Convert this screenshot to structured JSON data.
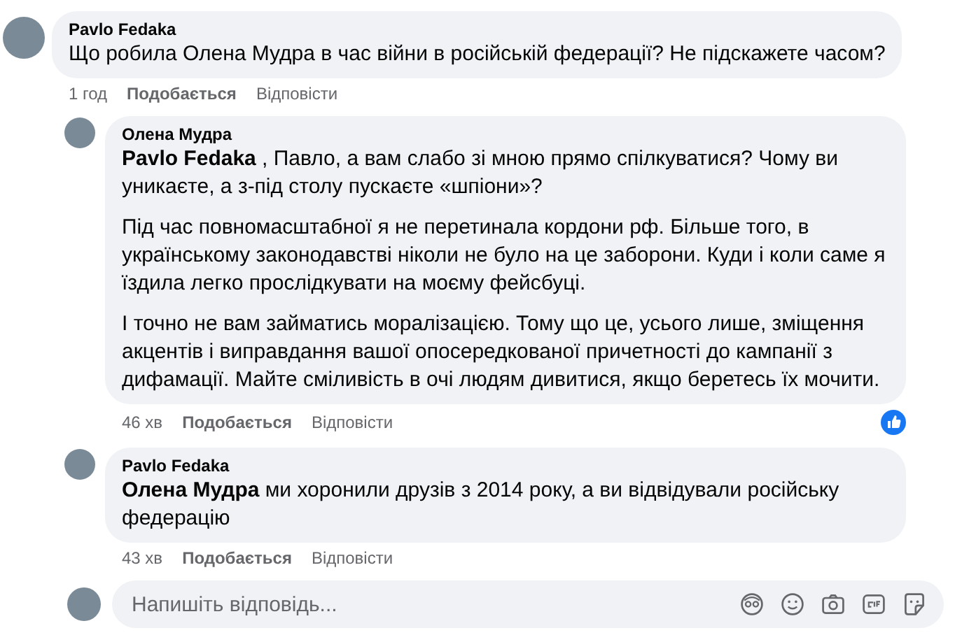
{
  "comments": [
    {
      "author": "Pavlo Fedaka",
      "paragraphs": [
        "Що робила Олена Мудра в час війни в російській федерації? Не підскажете часом?"
      ],
      "time": "1 год",
      "like_label": "Подобається",
      "reply_label": "Відповісти",
      "reply": false,
      "liked_reaction": false
    },
    {
      "author": "Олена Мудра",
      "paragraphs": [
        "**Pavlo Fedaka** , Павло, а вам слабо зі мною прямо спілкуватися? Чому ви уникаєте, а з-під столу пускаєте «шпіони»?",
        "Під час повномасштабної я не перетинала кордони рф. Більше того, в українському законодавстві ніколи не було на це заборони. Куди і коли саме я їздила легко прослідкувати на моєму фейсбуці.",
        "І точно не вам займатись моралізацією. Тому що це, усього лише, зміщення акцентів і виправдання вашої опосередкованої причетності до кампанії з дифамації. Майте сміливість в очі людям дивитися, якщо беретесь їх мочити."
      ],
      "time": "46 хв",
      "like_label": "Подобається",
      "reply_label": "Відповісти",
      "reply": true,
      "liked_reaction": true
    },
    {
      "author": "Pavlo Fedaka",
      "paragraphs": [
        "**Олена Мудра** ми хоронили друзів з 2014 року, а ви відвідували російську федерацію"
      ],
      "time": "43 хв",
      "like_label": "Подобається",
      "reply_label": "Відповісти",
      "reply": true,
      "liked_reaction": false
    }
  ],
  "composer": {
    "placeholder": "Напишіть відповідь..."
  }
}
